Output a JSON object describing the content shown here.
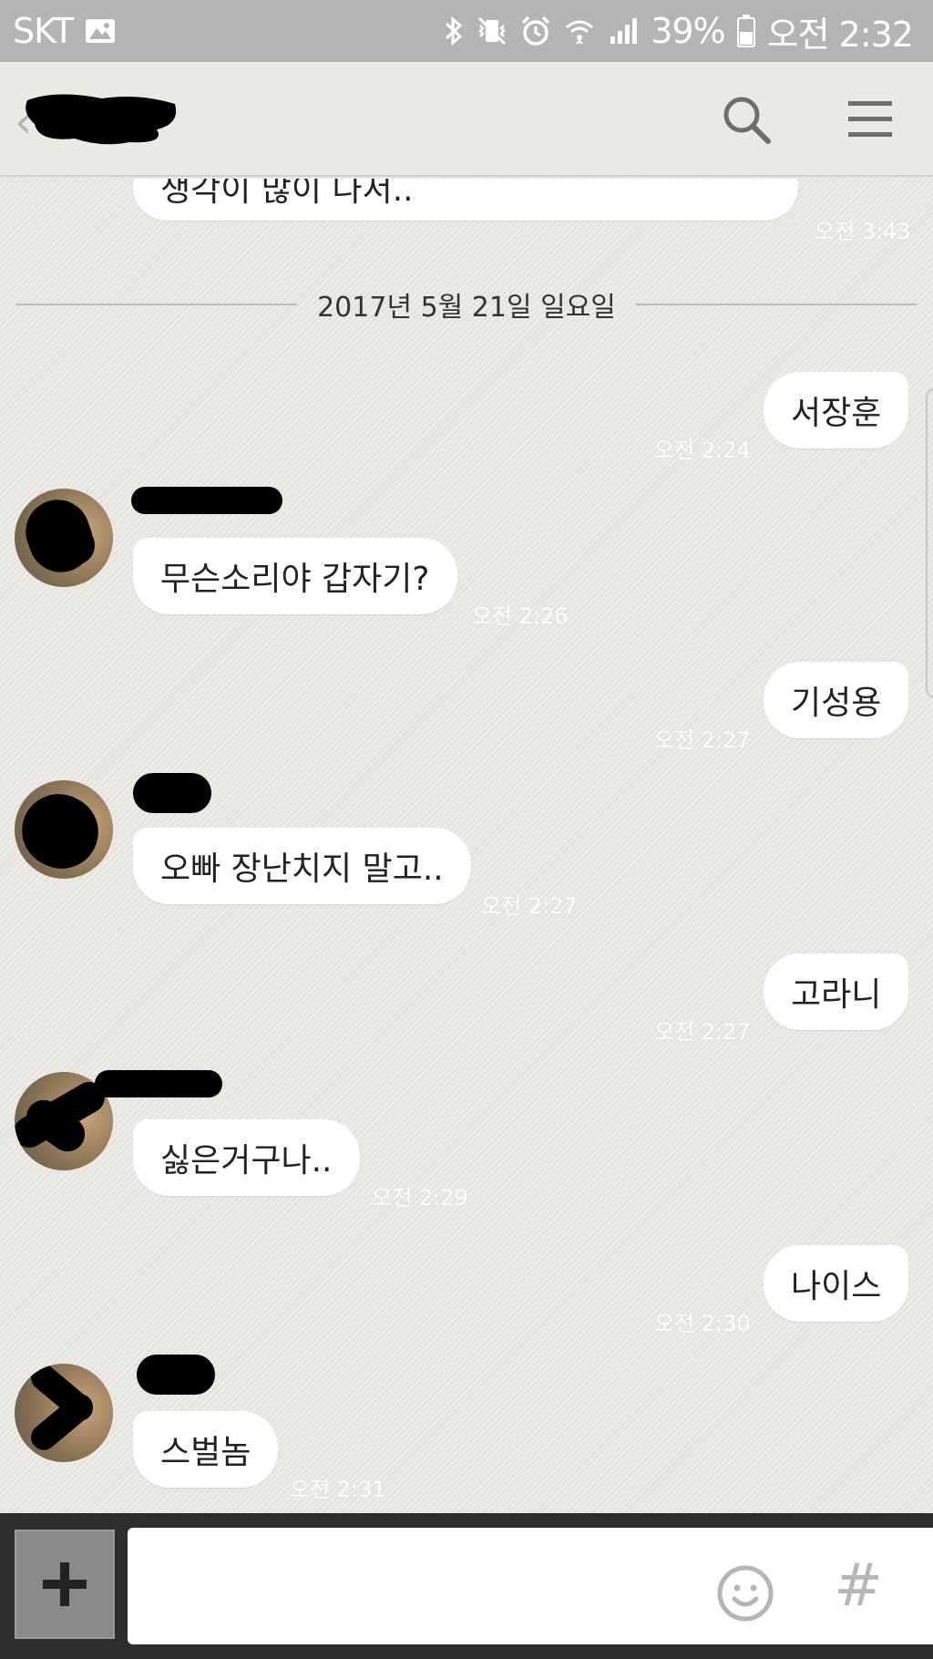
{
  "status_bar": {
    "carrier": "SKT",
    "battery": "39%",
    "time": "오전 2:32",
    "icons": [
      "gallery-icon",
      "bluetooth-icon",
      "vibrate-icon",
      "alarm-icon",
      "wifi-icon",
      "signal-icon",
      "battery-icon"
    ]
  },
  "header": {
    "title": "",
    "icons": [
      "back-icon",
      "search-icon",
      "menu-icon"
    ]
  },
  "chat": {
    "prev_message": {
      "text": "생각이 많이 나서..",
      "time": "오전 3:43"
    },
    "date_separator": "2017년 5월 21일 일요일",
    "messages": [
      {
        "direction": "out",
        "text": "서장훈",
        "time": "오전 2:24"
      },
      {
        "direction": "in",
        "text": "무슨소리야 갑자기?",
        "time": "오전 2:26"
      },
      {
        "direction": "out",
        "text": "기성용",
        "time": "오전 2:27"
      },
      {
        "direction": "in",
        "text": "오빠 장난치지 말고..",
        "time": "오전 2:27"
      },
      {
        "direction": "out",
        "text": "고라니",
        "time": "오전 2:27"
      },
      {
        "direction": "in",
        "text": "싫은거구나..",
        "time": "오전 2:29"
      },
      {
        "direction": "out",
        "text": "나이스",
        "time": "오전 2:30"
      },
      {
        "direction": "in",
        "text": "스벌놈",
        "time": "오전 2:31"
      }
    ]
  },
  "input_bar": {
    "placeholder": "",
    "hash_label": "#",
    "icons": [
      "plus-icon",
      "emoji-icon"
    ]
  },
  "colors": {
    "background": "#e9e7e2",
    "status_bar": "#b4b4b4",
    "bubble": "#ffffff",
    "input_bar": "#2d2d2d"
  }
}
